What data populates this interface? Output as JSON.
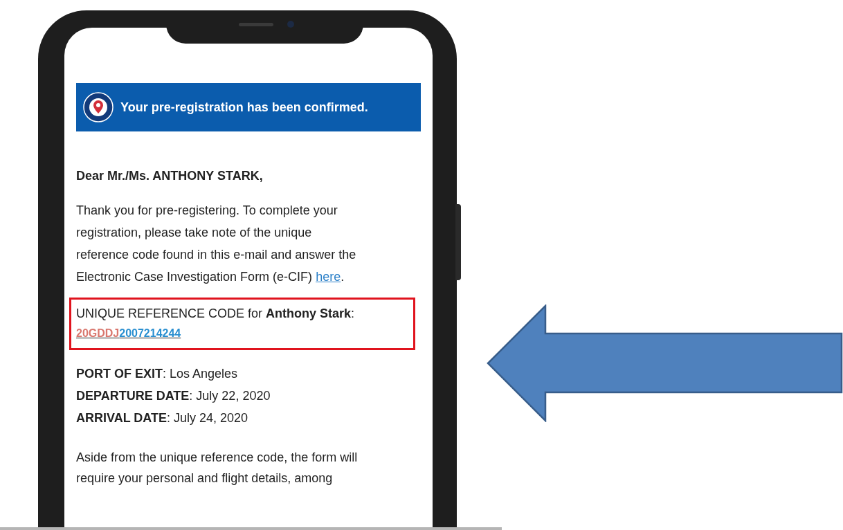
{
  "banner": {
    "title": "Your pre-registration has been confirmed."
  },
  "greeting": "Dear Mr./Ms. ANTHONY STARK,",
  "intro": {
    "lines": [
      "Thank you for pre-registering. To complete your",
      "registration, please take note of the unique",
      "reference code found in this e-mail and answer the"
    ],
    "last_line": "Electronic Case Investigation Form (e-CIF)",
    "link": "here",
    "end": "."
  },
  "reference": {
    "label": "UNIQUE REFERENCE CODE for **Anthony Stark**:",
    "code_prefix": "20GDDJ",
    "code_number": "2007214244"
  },
  "details": [
    {
      "label": "PORT OF EXIT",
      "value": ": Los Angeles"
    },
    {
      "label": "DEPARTURE DATE",
      "value": ": July 22, 2020"
    },
    {
      "label": "ARRIVAL DATE",
      "value": ": July 24, 2020"
    }
  ],
  "closing": {
    "lines": [
      "Aside from the unique reference code, the form will",
      "require your personal and flight details, among"
    ]
  }
}
